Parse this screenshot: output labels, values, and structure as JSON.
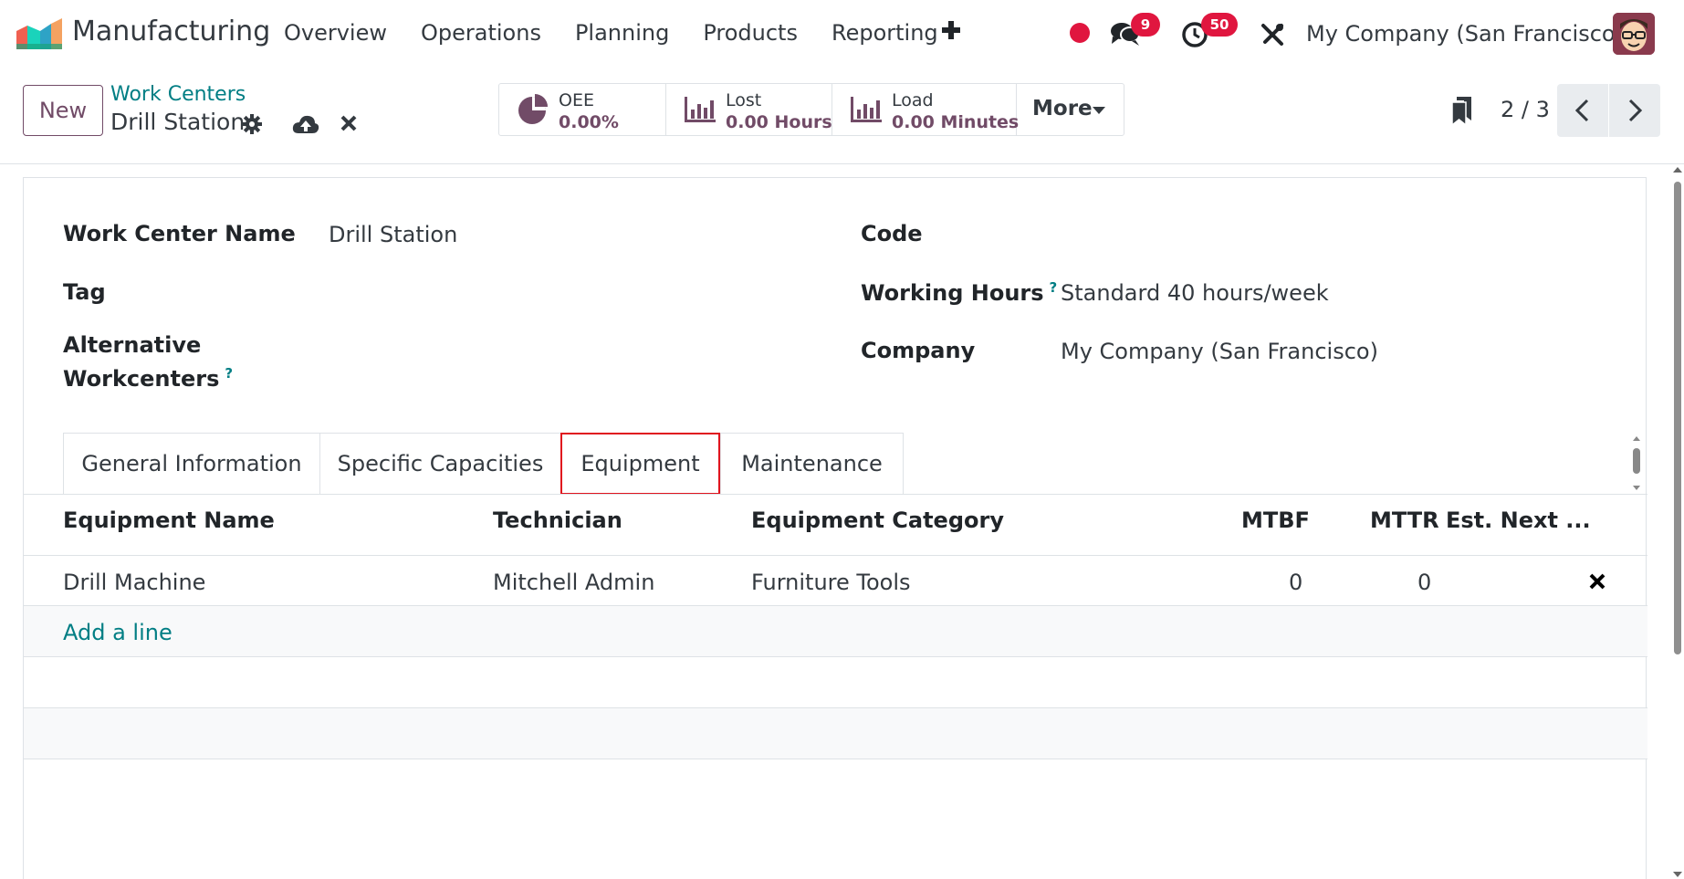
{
  "navbar": {
    "app_title": "Manufacturing",
    "menu": [
      "Overview",
      "Operations",
      "Planning",
      "Products",
      "Reporting"
    ],
    "chat_badge": "9",
    "activity_badge": "50",
    "company": "My Company (San Francisco)",
    "icons": [
      "app-logo",
      "plus-icon",
      "record-dot-icon",
      "chat-icon",
      "clock-icon",
      "tools-icon",
      "avatar"
    ]
  },
  "control": {
    "new_label": "New",
    "breadcrumb_parent": "Work Centers",
    "breadcrumb_current": "Drill Station",
    "smart_buttons": [
      {
        "label": "OEE",
        "value": "0.00%",
        "icon": "pie-chart-icon"
      },
      {
        "label": "Lost",
        "value": "0.00 Hours",
        "icon": "bar-chart-icon"
      },
      {
        "label": "Load",
        "value": "0.00 Minutes",
        "icon": "bar-chart-icon"
      }
    ],
    "more_label": "More",
    "pager": "2 / 3"
  },
  "form": {
    "fields": {
      "work_center_name_label": "Work Center Name",
      "work_center_name_value": "Drill Station",
      "tag_label": "Tag",
      "alt_label_line1": "Alternative",
      "alt_label_line2": "Workcenters",
      "code_label": "Code",
      "working_hours_label": "Working Hours",
      "working_hours_value": "Standard 40 hours/week",
      "company_label": "Company",
      "company_value": "My Company (San Francisco)",
      "help_mark": "?"
    },
    "tabs": [
      "General Information",
      "Specific Capacities",
      "Equipment",
      "Maintenance"
    ],
    "active_tab": "Equipment"
  },
  "equipment": {
    "columns": [
      "Equipment Name",
      "Technician",
      "Equipment Category",
      "MTBF",
      "MTTR",
      "Est. Next ..."
    ],
    "rows": [
      {
        "name": "Drill Machine",
        "technician": "Mitchell Admin",
        "category": "Furniture Tools",
        "mtbf": "0",
        "mttr": "0"
      }
    ],
    "add_line": "Add a line"
  },
  "colors": {
    "brand": "#714b67",
    "link": "#017e84",
    "badge": "#e0163f",
    "active_tab_outline": "#e0141e"
  }
}
